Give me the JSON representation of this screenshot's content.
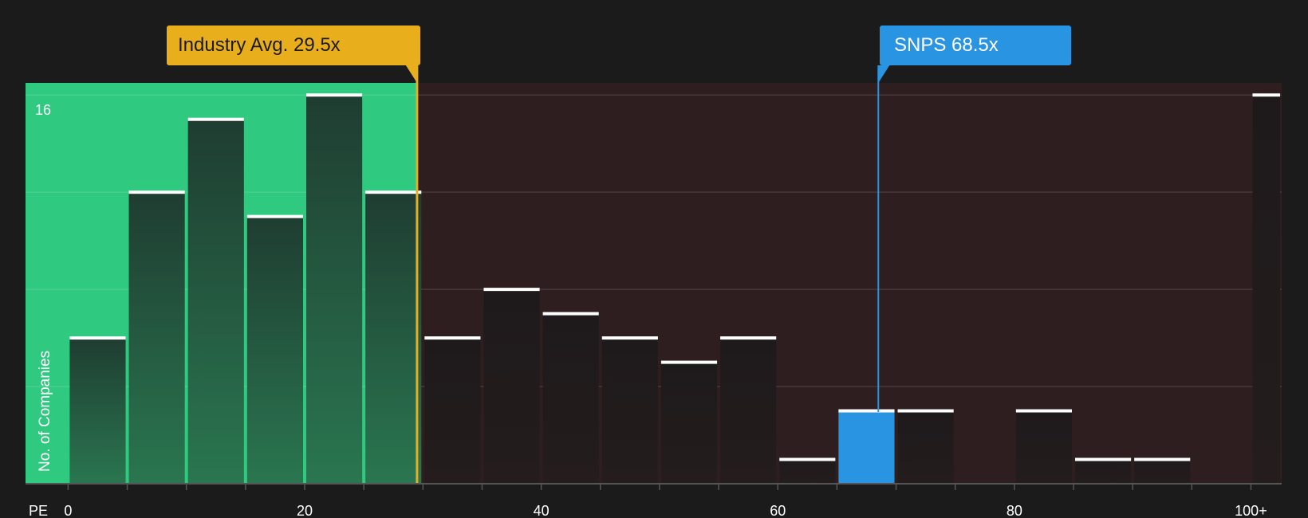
{
  "chart_data": {
    "type": "bar",
    "xlabel": "PE",
    "ylabel": "No. of Companies",
    "x_tick_labels": [
      "0",
      "20",
      "40",
      "60",
      "80",
      "100+"
    ],
    "x_ticks": [
      0,
      20,
      40,
      60,
      80,
      100
    ],
    "xlim": [
      -3.6,
      102.6
    ],
    "ylim": [
      0,
      16.5
    ],
    "y_top_label": "16",
    "bin_width": 5,
    "bins": [
      {
        "start": 0,
        "end": 5,
        "value": 6
      },
      {
        "start": 5,
        "end": 10,
        "value": 12
      },
      {
        "start": 10,
        "end": 15,
        "value": 15
      },
      {
        "start": 15,
        "end": 20,
        "value": 11
      },
      {
        "start": 20,
        "end": 25,
        "value": 16
      },
      {
        "start": 25,
        "end": 30,
        "value": 12
      },
      {
        "start": 30,
        "end": 35,
        "value": 6
      },
      {
        "start": 35,
        "end": 40,
        "value": 8
      },
      {
        "start": 40,
        "end": 45,
        "value": 7
      },
      {
        "start": 45,
        "end": 50,
        "value": 6
      },
      {
        "start": 50,
        "end": 55,
        "value": 5
      },
      {
        "start": 55,
        "end": 60,
        "value": 6
      },
      {
        "start": 60,
        "end": 65,
        "value": 1
      },
      {
        "start": 65,
        "end": 70,
        "value": 3,
        "highlight": true
      },
      {
        "start": 70,
        "end": 75,
        "value": 3
      },
      {
        "start": 75,
        "end": 80,
        "value": 0
      },
      {
        "start": 80,
        "end": 85,
        "value": 3
      },
      {
        "start": 85,
        "end": 90,
        "value": 1
      },
      {
        "start": 90,
        "end": 95,
        "value": 1
      },
      {
        "start": 95,
        "end": 100,
        "value": 0
      },
      {
        "start": 100,
        "end": 102.6,
        "value": 16
      }
    ],
    "industry_avg": {
      "label": "Industry Avg. 29.5x",
      "value": 29.5,
      "color": "#e9ae1c"
    },
    "company": {
      "label": "SNPS 68.5x",
      "value": 68.5,
      "color": "#2894e2"
    },
    "colors": {
      "background": "#1b1b1b",
      "below_avg_region": "#2fc97f",
      "above_avg_region": "#2e1e1f",
      "bar_dark": "#1d1d1d",
      "highlight_bar": "#2894e2",
      "bar_cap": "#ffffff"
    }
  }
}
